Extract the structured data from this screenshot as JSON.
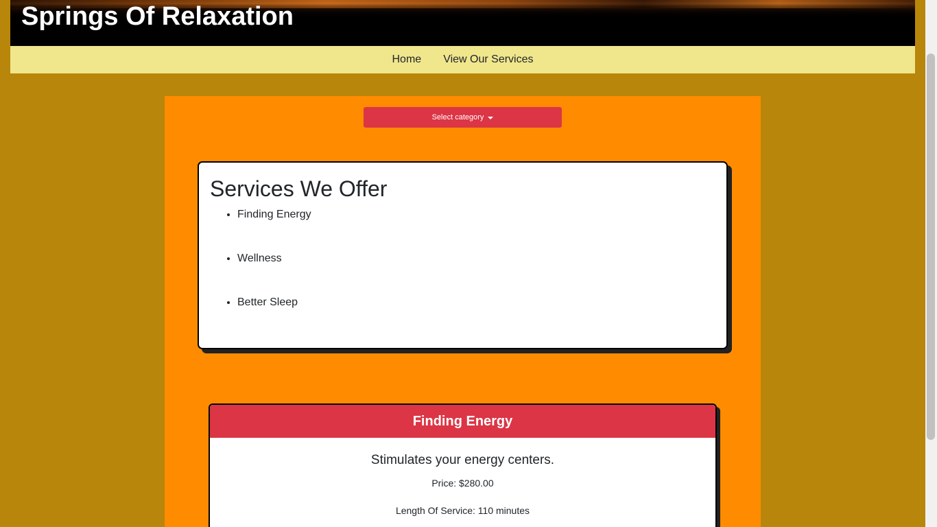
{
  "header": {
    "site_title": "Springs Of Relaxation"
  },
  "nav": {
    "items": [
      {
        "label": "Home"
      },
      {
        "label": "View Our Services"
      }
    ]
  },
  "category_select": {
    "label": "Select category"
  },
  "services_overview": {
    "title": "Services We Offer",
    "items": [
      "Finding Energy",
      "Wellness",
      "Better Sleep"
    ]
  },
  "service_card": {
    "name": "Finding Energy",
    "description": "Stimulates your energy centers.",
    "price_text": "Price: $280.00",
    "length_text": "Length Of Service: 110 minutes"
  },
  "colors": {
    "page_background": "#b8860b",
    "navbar": "#f0e68c",
    "content_background": "#ff8c00",
    "accent_red": "#dc3545"
  }
}
